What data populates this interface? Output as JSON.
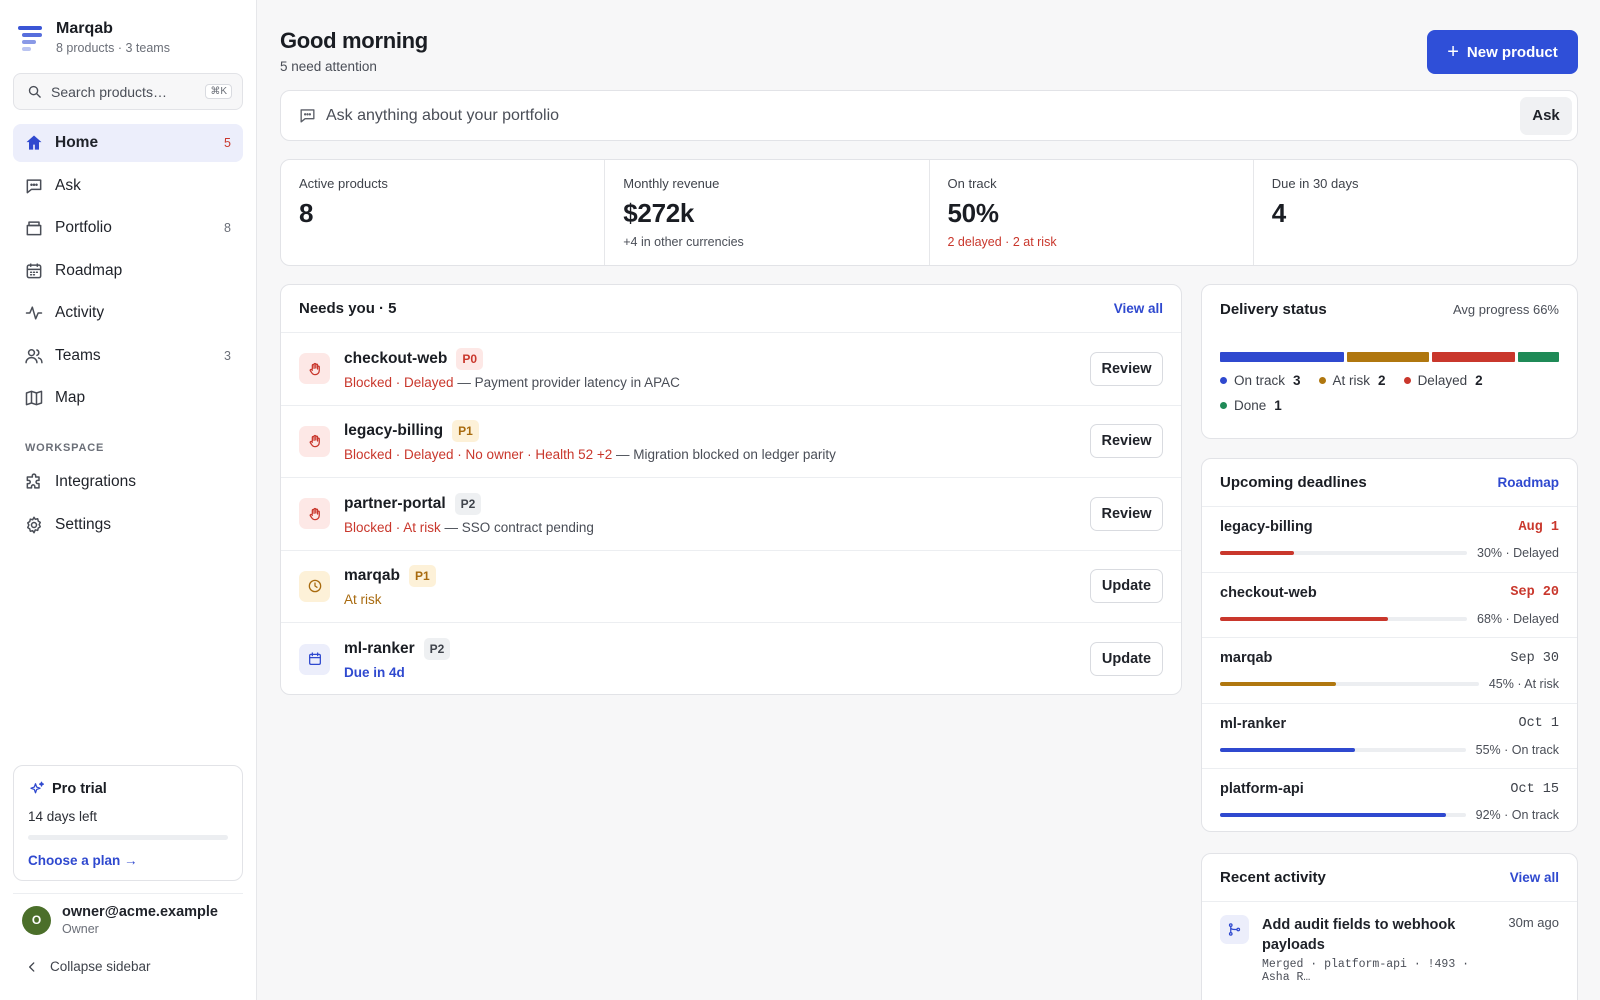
{
  "brand": {
    "name": "Marqab",
    "subtitle": "8 products · 3 teams"
  },
  "search": {
    "placeholder": "Search products…",
    "shortcut": "⌘K"
  },
  "nav": [
    {
      "label": "Home",
      "count": "5",
      "icon": "home-icon",
      "active": true
    },
    {
      "label": "Ask",
      "count": "",
      "icon": "chat-icon"
    },
    {
      "label": "Portfolio",
      "count": "8",
      "icon": "box-icon"
    },
    {
      "label": "Roadmap",
      "count": "",
      "icon": "calendar-icon"
    },
    {
      "label": "Activity",
      "count": "",
      "icon": "pulse-icon"
    },
    {
      "label": "Teams",
      "count": "3",
      "icon": "users-icon"
    },
    {
      "label": "Map",
      "count": "",
      "icon": "map-icon"
    }
  ],
  "workspace": {
    "label": "WORKSPACE",
    "items": [
      {
        "label": "Integrations",
        "icon": "puzzle-icon"
      },
      {
        "label": "Settings",
        "icon": "gear-icon"
      }
    ]
  },
  "trial": {
    "title": "Pro trial",
    "days_left": "14 days left",
    "progress": 0.0,
    "link": "Choose a plan →"
  },
  "user": {
    "initial": "O",
    "email": "owner@acme.example",
    "role": "Owner"
  },
  "collapse_label": "Collapse sidebar",
  "header": {
    "greeting": "Good morning",
    "subtitle": "5 need attention",
    "new_button": "New product"
  },
  "ask": {
    "placeholder": "Ask anything about your portfolio",
    "button": "Ask"
  },
  "stats": [
    {
      "label": "Active products",
      "value": "8",
      "note": ""
    },
    {
      "label": "Monthly revenue",
      "value": "$272k",
      "note": "+4 in other currencies"
    },
    {
      "label": "On track",
      "value": "50%",
      "note": "2 delayed · 2 at risk",
      "alert": true
    },
    {
      "label": "Due in 30 days",
      "value": "4",
      "note": ""
    }
  ],
  "needs": {
    "title": "Needs you · 5",
    "view_all": "View all",
    "items": [
      {
        "name": "checkout-web",
        "priority": "P0",
        "flags": "Blocked · Delayed",
        "note": " — Payment provider latency in APAC",
        "action": "Review",
        "kind": "blocked"
      },
      {
        "name": "legacy-billing",
        "priority": "P1",
        "flags": "Blocked · Delayed · No owner · Health 52 +2",
        "note": " — Migration blocked on ledger parity",
        "action": "Review",
        "kind": "blocked"
      },
      {
        "name": "partner-portal",
        "priority": "P2",
        "flags": "Blocked · At risk",
        "note": " — SSO contract pending",
        "action": "Review",
        "kind": "blocked"
      },
      {
        "name": "marqab",
        "priority": "P1",
        "flags": "At risk",
        "note": "",
        "action": "Update",
        "kind": "risk"
      },
      {
        "name": "ml-ranker",
        "priority": "P2",
        "flags": "Due in 4d",
        "note": "",
        "action": "Update",
        "kind": "due"
      }
    ]
  },
  "delivery": {
    "title": "Delivery status",
    "avg": "Avg progress 66%",
    "colors": {
      "on_track": "#2f49cf",
      "at_risk": "#b0770f",
      "delayed": "#c9372c",
      "done": "#1f8a57"
    },
    "segments": [
      {
        "label": "On track",
        "count": 3,
        "color": "#2f49cf"
      },
      {
        "label": "At risk",
        "count": 2,
        "color": "#b0770f"
      },
      {
        "label": "Delayed",
        "count": 2,
        "color": "#c9372c"
      },
      {
        "label": "Done",
        "count": 1,
        "color": "#1f8a57"
      }
    ]
  },
  "deadlines": {
    "title": "Upcoming deadlines",
    "link": "Roadmap",
    "items": [
      {
        "name": "legacy-billing",
        "date": "Aug 1",
        "progress": 30,
        "status": "30% · Delayed",
        "color": "#c9372c",
        "alert": true
      },
      {
        "name": "checkout-web",
        "date": "Sep 20",
        "progress": 68,
        "status": "68% · Delayed",
        "color": "#c9372c",
        "alert": true
      },
      {
        "name": "marqab",
        "date": "Sep 30",
        "progress": 45,
        "status": "45% · At risk",
        "color": "#b0770f",
        "alert": false
      },
      {
        "name": "ml-ranker",
        "date": "Oct 1",
        "progress": 55,
        "status": "55% · On track",
        "color": "#2f49cf",
        "alert": false
      },
      {
        "name": "platform-api",
        "date": "Oct 15",
        "progress": 92,
        "status": "92% · On track",
        "color": "#2f49cf",
        "alert": false
      }
    ]
  },
  "activity": {
    "title": "Recent activity",
    "view_all": "View all",
    "items": [
      {
        "title": "Add audit fields to webhook payloads",
        "meta": "Merged · platform-api · !493 · Asha R…",
        "time": "30m ago",
        "icon": "git-merge-icon"
      }
    ]
  }
}
